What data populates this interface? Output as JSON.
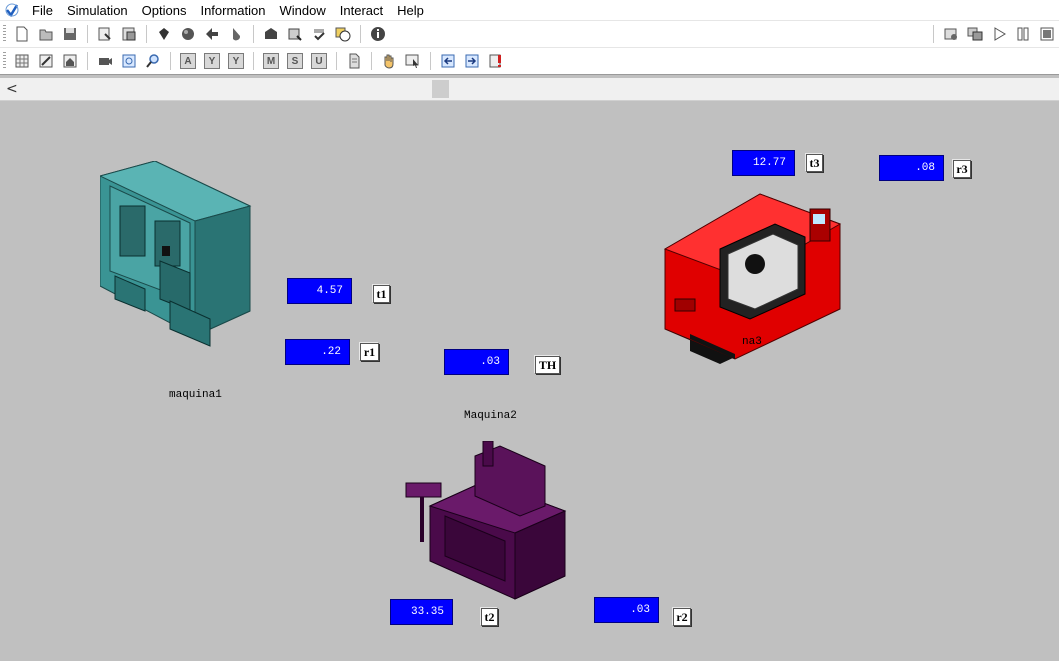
{
  "menubar": {
    "items": [
      "File",
      "Simulation",
      "Options",
      "Information",
      "Window",
      "Interact",
      "Help"
    ]
  },
  "toolbar2": {
    "letter_buttons": [
      "A",
      "Y",
      "Y",
      "M",
      "S",
      "U"
    ]
  },
  "scrollbar": {
    "left_arrow": "<"
  },
  "canvas": {
    "machines": [
      {
        "name": "maquina1",
        "color": "#3a9494"
      },
      {
        "name": "Maquina2",
        "color": "#4a0a4a"
      },
      {
        "name": "maquina3",
        "visible_name": "na3",
        "color": "#e00000"
      }
    ],
    "value_boxes": {
      "t1": "4.57",
      "r1": ".22",
      "th": ".03",
      "t2": "33.35",
      "r2": ".03",
      "t3": "12.77",
      "r3": ".08"
    },
    "labels": {
      "t1": "t1",
      "r1": "r1",
      "th": "TH",
      "t2": "t2",
      "r2": "r2",
      "t3": "t3",
      "r3": "r3"
    },
    "value_box_color": "#0000ff"
  }
}
